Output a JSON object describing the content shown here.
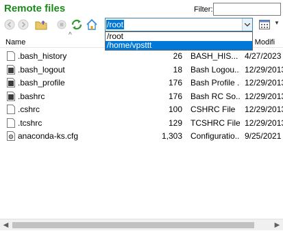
{
  "header": {
    "title": "Remote files",
    "filter_label": "Filter:",
    "filter_value": ""
  },
  "toolbar": {
    "path_value": "/root",
    "dropdown_options": [
      "/root",
      "/home/vpsttt"
    ],
    "dropdown_selected_index": 1
  },
  "columns": {
    "name": "Name",
    "date": "ite Modifi"
  },
  "files": [
    {
      "name": ".bash_history",
      "size": "26",
      "type": "BASH_HIS...",
      "date": "4/27/2023",
      "icon": "text-file-icon"
    },
    {
      "name": ".bash_logout",
      "size": "18",
      "type": "Bash Logou...",
      "date": "12/29/2013",
      "icon": "script-file-icon"
    },
    {
      "name": ".bash_profile",
      "size": "176",
      "type": "Bash Profile ...",
      "date": "12/29/2013",
      "icon": "script-file-icon"
    },
    {
      "name": ".bashrc",
      "size": "176",
      "type": "Bash RC So...",
      "date": "12/29/2013",
      "icon": "script-file-icon"
    },
    {
      "name": ".cshrc",
      "size": "100",
      "type": "CSHRC File",
      "date": "12/29/2013",
      "icon": "text-file-icon"
    },
    {
      "name": ".tcshrc",
      "size": "129",
      "type": "TCSHRC File",
      "date": "12/29/2013",
      "icon": "text-file-icon"
    },
    {
      "name": "anaconda-ks.cfg",
      "size": "1,303",
      "type": "Configuratio...",
      "date": "9/25/2021",
      "icon": "config-file-icon"
    }
  ],
  "colors": {
    "title_green": "#1a8a1a",
    "selection_blue": "#0078d7"
  }
}
